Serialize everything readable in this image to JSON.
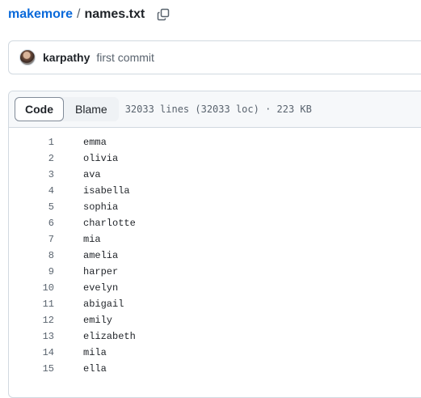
{
  "breadcrumb": {
    "repo": "makemore",
    "separator": "/",
    "file": "names.txt",
    "copy_icon": "copy-icon"
  },
  "commit": {
    "author": "karpathy",
    "message": "first commit"
  },
  "file": {
    "tabs": [
      {
        "label": "Code",
        "active": true
      },
      {
        "label": "Blame",
        "active": false
      }
    ],
    "info": "32033 lines (32033 loc) · 223 KB",
    "lines": [
      {
        "n": "1",
        "text": "emma"
      },
      {
        "n": "2",
        "text": "olivia"
      },
      {
        "n": "3",
        "text": "ava"
      },
      {
        "n": "4",
        "text": "isabella"
      },
      {
        "n": "5",
        "text": "sophia"
      },
      {
        "n": "6",
        "text": "charlotte"
      },
      {
        "n": "7",
        "text": "mia"
      },
      {
        "n": "8",
        "text": "amelia"
      },
      {
        "n": "9",
        "text": "harper"
      },
      {
        "n": "10",
        "text": "evelyn"
      },
      {
        "n": "11",
        "text": "abigail"
      },
      {
        "n": "12",
        "text": "emily"
      },
      {
        "n": "13",
        "text": "elizabeth"
      },
      {
        "n": "14",
        "text": "mila"
      },
      {
        "n": "15",
        "text": "ella"
      }
    ]
  },
  "colors": {
    "link": "#0969da",
    "text": "#1f2328",
    "muted": "#59636e",
    "border": "#d1d9e0",
    "header_bg": "#f6f8fa"
  }
}
